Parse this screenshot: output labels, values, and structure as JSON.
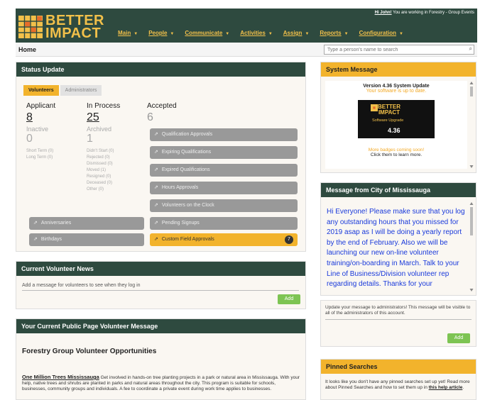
{
  "brand": {
    "line1": "BETTER",
    "line2": "IMPACT",
    "colors": {
      "header": "#2e4a3f",
      "accent": "#f2b32c",
      "green_button": "#7dc453",
      "message_text": "#1a3adb"
    }
  },
  "userbar": {
    "user": "Hi John!",
    "context": "You are working in Forestry - Group Events"
  },
  "nav": [
    "Main",
    "People",
    "Communicate",
    "Activities",
    "Assign",
    "Reports",
    "Configuration"
  ],
  "breadcrumb": "Home",
  "search": {
    "placeholder": "Type a person's name to search",
    "icon": "search-icon"
  },
  "status": {
    "title": "Status Update",
    "tabs": [
      "Volunteers",
      "Administrators"
    ],
    "applicant": {
      "label": "Applicant",
      "count": "8",
      "sub_label": "Inactive",
      "sub_count": "0",
      "details": [
        "Short Term (0)",
        "Long Term (0)"
      ]
    },
    "in_process": {
      "label": "In Process",
      "count": "25",
      "sub_label": "Archived",
      "sub_count": "1",
      "details": [
        "Didn't Start (0)",
        "Rejected (0)",
        "Dismissed (0)",
        "Moved (1)",
        "Resigned (0)",
        "Deceased (0)",
        "Other (0)"
      ]
    },
    "accepted": {
      "label": "Accepted",
      "count": "6"
    },
    "buttons": {
      "qualification": "Qualification Approvals",
      "expiring": "Expiring Qualifications",
      "expired": "Expired Qualifications",
      "hours": "Hours Approvals",
      "on_clock": "Volunteers on the Clock",
      "anniversaries": "Anniversaries",
      "pending": "Pending Signups",
      "birthdays": "Birthdays",
      "custom_field": "Custom Field Approvals",
      "custom_field_count": "7"
    }
  },
  "news": {
    "title": "Current Volunteer News",
    "placeholder": "Add a message for volunteers to see when they log in",
    "add": "Add"
  },
  "public_page": {
    "title": "Your Current Public Page Volunteer Message",
    "heading": "Forestry Group Volunteer Opportunities",
    "link": "One Million Trees Mississauga",
    "body": " Get involved in hands-on tree planting projects in a park or natural area in Mississauga. With your help, native trees and shrubs are planted in parks and natural areas throughout the city. This program is suitable for schools, businesses, community groups and individuals. A fee to coordinate a private event during work time applies to businesses."
  },
  "system_message": {
    "title": "System Message",
    "version": "Version 4.36 System Update",
    "status": "Your software is up to date.",
    "image_line": "Software Upgrade",
    "image_version": "4.36",
    "badges": "More badges coming soon!",
    "learn": "Click them to learn more."
  },
  "city_message": {
    "title": "Message from City of Mississauga",
    "text": "Hi Everyone!  Please make sure that you log any outstanding hours that you missed for 2019 asap as I will be doing a yearly report by the end of February. Also we will be launching our new on-line volunteer training/on-boarding in March.  Talk to your Line of Business/Division volunteer rep regarding details.  Thanks for your"
  },
  "admin_update": {
    "text": "Update your message to administrators! This message will be visible to all of the administrators of this account.",
    "add": "Add"
  },
  "pinned": {
    "title": "Pinned Searches",
    "text": "It looks like you don't have any pinned searches set up yet! Read more about Pinned Searches and how to set them up in ",
    "link": "this help article",
    "end": "."
  }
}
